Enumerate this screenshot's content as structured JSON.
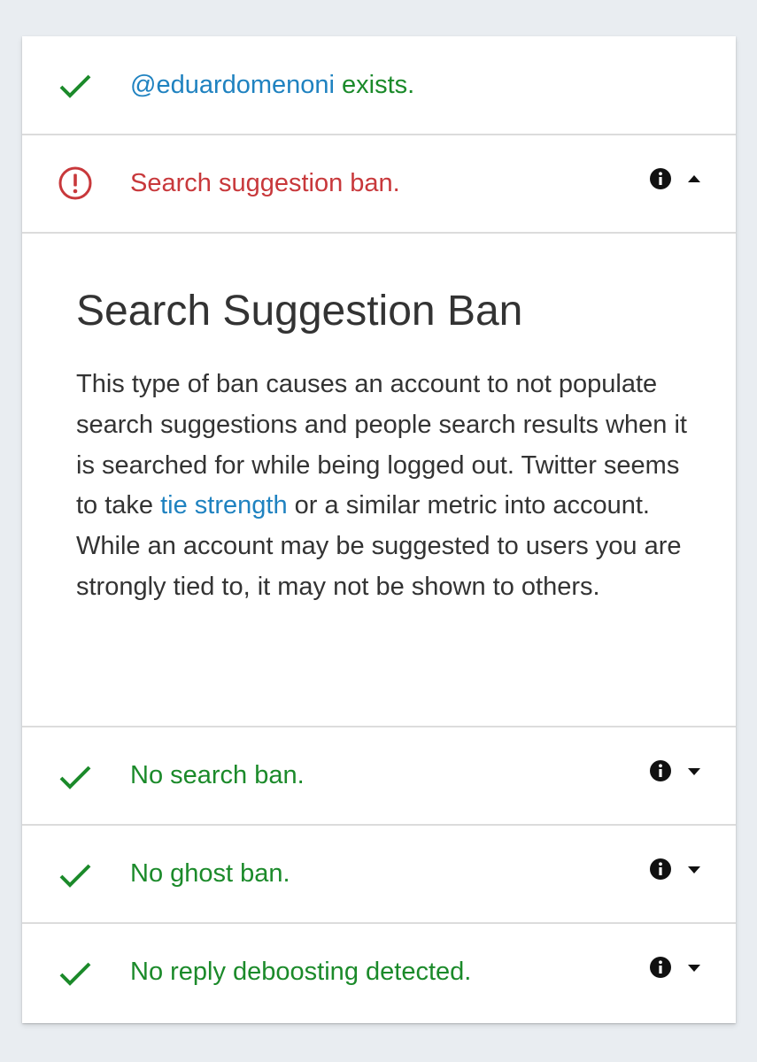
{
  "colors": {
    "success": "#1b8a2a",
    "error": "#c8383b",
    "link": "#1f82c0",
    "text": "#333333"
  },
  "rows": {
    "exists": {
      "handle": "@eduardomenoni",
      "suffix": " exists.",
      "icon": "checkmark-icon"
    },
    "suggestion_ban": {
      "label": "Search suggestion ban.",
      "icon": "alert-circle-icon",
      "expanded": true
    },
    "search_ban": {
      "label": "No search ban.",
      "icon": "checkmark-icon",
      "expanded": false
    },
    "ghost_ban": {
      "label": "No ghost ban.",
      "icon": "checkmark-icon",
      "expanded": false
    },
    "reply_deboosting": {
      "label": "No reply deboosting detected.",
      "icon": "checkmark-icon",
      "expanded": false
    }
  },
  "detail": {
    "title": "Search Suggestion Ban",
    "text_before": "This type of ban causes an account to not populate search suggestions and people search results when it is searched for while being logged out. Twitter seems to take ",
    "link_text": "tie strength",
    "text_after": " or a similar metric into account. While an account may be suggested to users you are strongly tied to, it may not be shown to others."
  }
}
